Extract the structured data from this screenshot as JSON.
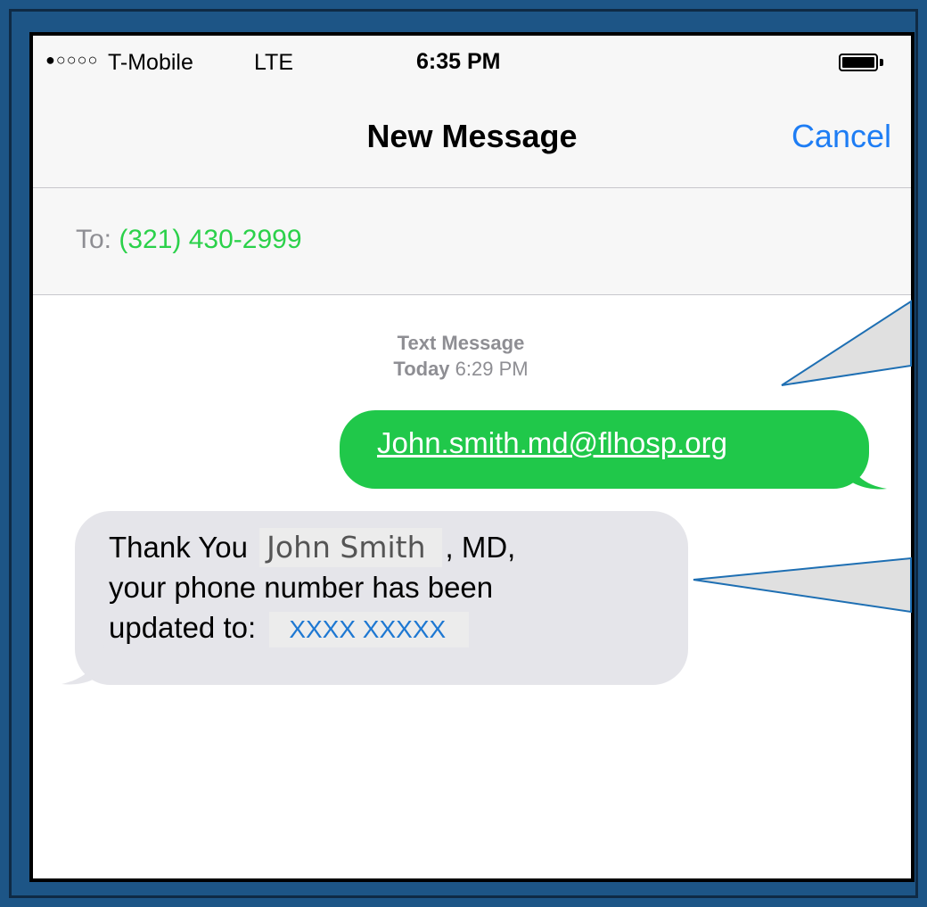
{
  "status_bar": {
    "signal": "●○○○○",
    "carrier": "T-Mobile",
    "network": "LTE",
    "time": "6:35 PM"
  },
  "nav": {
    "title": "New Message",
    "cancel_label": "Cancel"
  },
  "to_field": {
    "label": "To: ",
    "value": "(321) 430-2999"
  },
  "thread_meta": {
    "line1": "Text Message",
    "day": "Today",
    "time": "6:29 PM"
  },
  "sent_message": {
    "text": "John.smith.md@flhosp.org"
  },
  "received_message": {
    "prefix": "Thank You ",
    "name": "John Smith",
    "after_name": ", MD,",
    "line2": "your phone number has been",
    "line3_prefix": "updated to: ",
    "phone": "XXXX XXXXX"
  },
  "colors": {
    "accent_blue": "#1e7df4",
    "sent_green": "#20c84a",
    "frame_blue": "#1d5586"
  }
}
